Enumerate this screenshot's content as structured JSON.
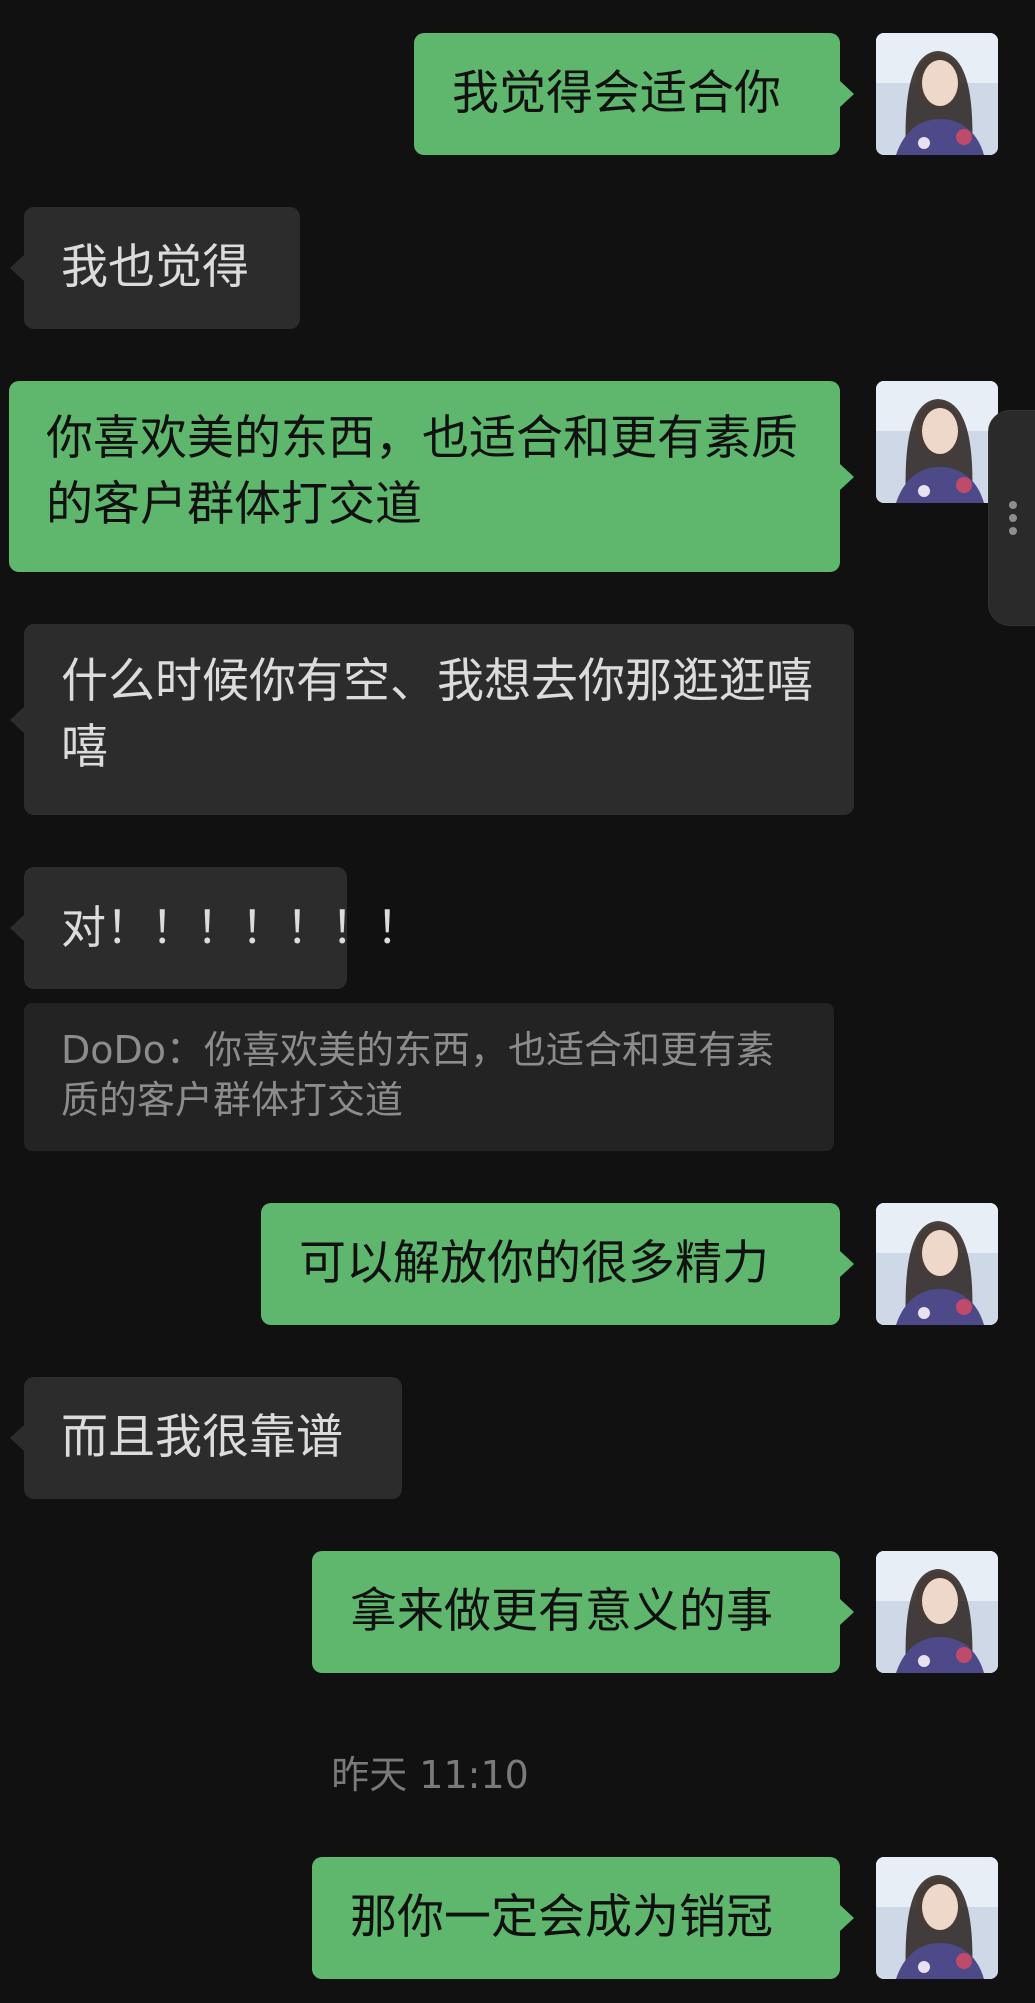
{
  "messages": [
    {
      "side": "out",
      "text": "我觉得会适合你"
    },
    {
      "side": "in",
      "text": "我也觉得"
    },
    {
      "side": "out",
      "text": "你喜欢美的东西，也适合和更有素质的客户群体打交道"
    },
    {
      "side": "in",
      "text": "什么时候你有空、我想去你那逛逛嘻嘻"
    },
    {
      "side": "in",
      "text": "对！！！！！！！"
    },
    {
      "side": "out",
      "text": "可以解放你的很多精力"
    },
    {
      "side": "in",
      "text": "而且我很靠谱"
    },
    {
      "side": "out",
      "text": "拿来做更有意义的事"
    },
    {
      "side": "out",
      "text": "那你一定会成为销冠"
    }
  ],
  "quote": {
    "text": "DoDo：你喜欢美的东西，也适合和更有素质的客户群体打交道"
  },
  "timestamp": "昨天 11:10",
  "colors": {
    "background": "#111111",
    "outgoing_bubble": "#5fb76e",
    "incoming_bubble": "#2c2c2c",
    "quote_background": "#232323"
  },
  "icons": {
    "avatar": "avatar-photo",
    "side_handle": "more-vertical-icon"
  }
}
